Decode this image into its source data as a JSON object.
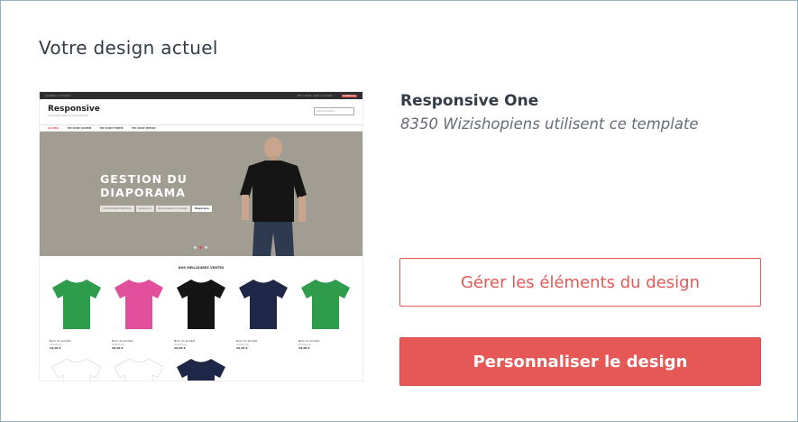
{
  "section_title": "Votre design actuel",
  "template": {
    "name": "Responsive One",
    "users_text": "8350 Wizishopiens utilisent ce template"
  },
  "buttons": {
    "manage_label": "Gérer les éléments du design",
    "customize_label": "Personnaliser le design"
  },
  "preview": {
    "topbar_left": "Inscription / Connexion",
    "topbar_right": "Mon compte · Créer un compte",
    "cart": "PANIER (0)",
    "logo": "Responsive",
    "tagline": "Le template responsive de Wizishop",
    "search_placeholder": "Votre recherche",
    "nav": [
      "ACCUEIL",
      "TEE SHIRT HOMME",
      "TEE SHIRT FEMME",
      "TEE SHIRT ENFANT"
    ],
    "hero_title_line1": "GESTION DU",
    "hero_title_line2": "DIAPORAMA",
    "breadcrumb": [
      "Administration WizIShop",
      "Apparence",
      "Personnaliser son design",
      "Diaporama"
    ],
    "best_sellers": "NOS MEILLEURES VENTES",
    "products": [
      {
        "name": "Nom du produit",
        "sub": "WizIShop",
        "price": "29,00 €"
      },
      {
        "name": "Nom du produit",
        "sub": "WizIShop",
        "price": "29,00 €"
      },
      {
        "name": "Nom du produit",
        "sub": "WizIShop",
        "price": "29,00 €"
      },
      {
        "name": "Nom du produit",
        "sub": "WizIShop",
        "price": "29,00 €"
      },
      {
        "name": "Nom du produit",
        "sub": "WizIShop",
        "price": "29,00 €"
      }
    ],
    "shirt_colors": [
      "#2e9c4b",
      "#e24f9c",
      "#141414",
      "#1e2747",
      "#2e9c4b",
      "#ffffff",
      "#ffffff",
      "#1e2747"
    ]
  },
  "colors": {
    "accent": "#e55855",
    "text_dark": "#333c47",
    "hero_bg": "#a29d93"
  }
}
